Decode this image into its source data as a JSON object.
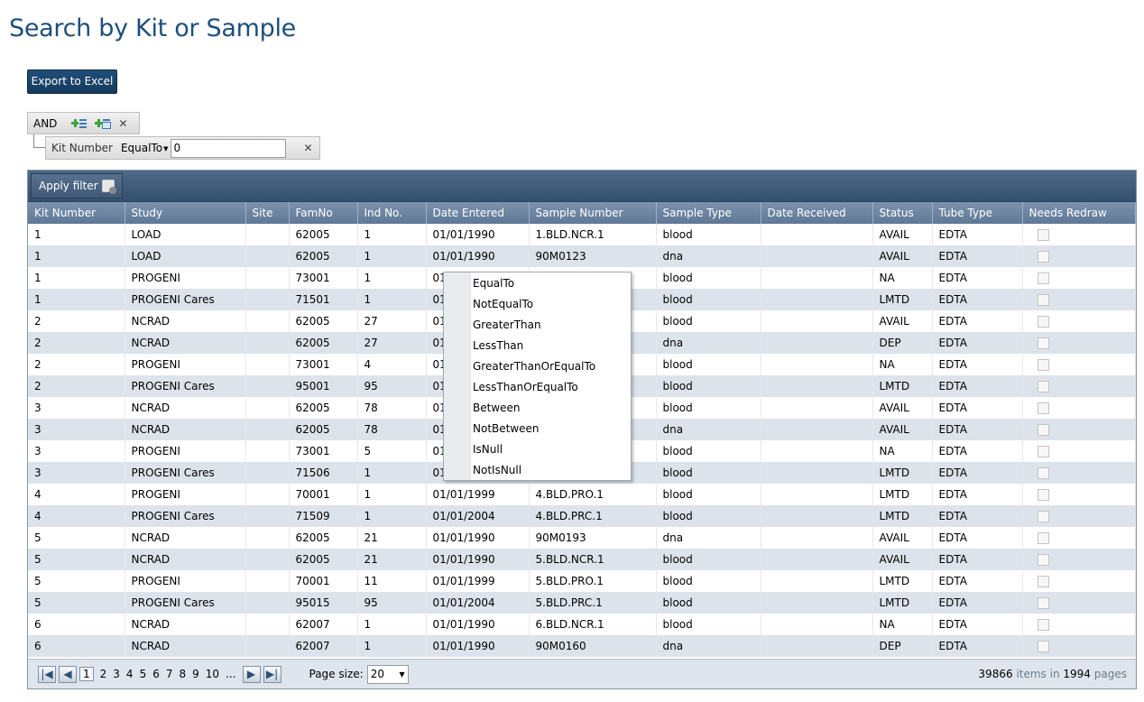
{
  "page": {
    "title": "Search by Kit or Sample"
  },
  "toolbar": {
    "export_label": "Export to Excel"
  },
  "filter": {
    "group_operator": "AND",
    "condition": {
      "field": "Kit Number",
      "operator": "EqualTo",
      "value": "0"
    }
  },
  "grid": {
    "apply_label": "Apply filter",
    "columns": [
      "Kit Number",
      "Study",
      "Site",
      "FamNo",
      "Ind No.",
      "Date Entered",
      "Sample Number",
      "Sample Type",
      "Date Received",
      "Status",
      "Tube Type",
      "Needs Redraw"
    ],
    "rows": [
      [
        "1",
        "LOAD",
        "",
        "62005",
        "1",
        "01/01/1990",
        "1.BLD.NCR.1",
        "blood",
        "",
        "AVAIL",
        "EDTA"
      ],
      [
        "1",
        "LOAD",
        "",
        "62005",
        "1",
        "01/01/1990",
        "90M0123",
        "dna",
        "",
        "AVAIL",
        "EDTA"
      ],
      [
        "1",
        "PROGENI",
        "",
        "73001",
        "1",
        "01",
        "",
        "blood",
        "",
        "NA",
        "EDTA"
      ],
      [
        "1",
        "PROGENI Cares",
        "",
        "71501",
        "1",
        "01",
        "",
        "blood",
        "",
        "LMTD",
        "EDTA"
      ],
      [
        "2",
        "NCRAD",
        "",
        "62005",
        "27",
        "01",
        "",
        "blood",
        "",
        "AVAIL",
        "EDTA"
      ],
      [
        "2",
        "NCRAD",
        "",
        "62005",
        "27",
        "01",
        "",
        "dna",
        "",
        "DEP",
        "EDTA"
      ],
      [
        "2",
        "PROGENI",
        "",
        "73001",
        "4",
        "01",
        "",
        "blood",
        "",
        "NA",
        "EDTA"
      ],
      [
        "2",
        "PROGENI Cares",
        "",
        "95001",
        "95",
        "01",
        "",
        "blood",
        "",
        "LMTD",
        "EDTA"
      ],
      [
        "3",
        "NCRAD",
        "",
        "62005",
        "78",
        "01",
        "",
        "blood",
        "",
        "AVAIL",
        "EDTA"
      ],
      [
        "3",
        "NCRAD",
        "",
        "62005",
        "78",
        "01",
        "",
        "dna",
        "",
        "AVAIL",
        "EDTA"
      ],
      [
        "3",
        "PROGENI",
        "",
        "73001",
        "5",
        "01",
        "",
        "blood",
        "",
        "NA",
        "EDTA"
      ],
      [
        "3",
        "PROGENI Cares",
        "",
        "71506",
        "1",
        "01",
        "",
        "blood",
        "",
        "LMTD",
        "EDTA"
      ],
      [
        "4",
        "PROGENI",
        "",
        "70001",
        "1",
        "01/01/1999",
        "4.BLD.PRO.1",
        "blood",
        "",
        "LMTD",
        "EDTA"
      ],
      [
        "4",
        "PROGENI Cares",
        "",
        "71509",
        "1",
        "01/01/2004",
        "4.BLD.PRC.1",
        "blood",
        "",
        "LMTD",
        "EDTA"
      ],
      [
        "5",
        "NCRAD",
        "",
        "62005",
        "21",
        "01/01/1990",
        "90M0193",
        "dna",
        "",
        "AVAIL",
        "EDTA"
      ],
      [
        "5",
        "NCRAD",
        "",
        "62005",
        "21",
        "01/01/1990",
        "5.BLD.NCR.1",
        "blood",
        "",
        "AVAIL",
        "EDTA"
      ],
      [
        "5",
        "PROGENI",
        "",
        "70001",
        "11",
        "01/01/1999",
        "5.BLD.PRO.1",
        "blood",
        "",
        "LMTD",
        "EDTA"
      ],
      [
        "5",
        "PROGENI Cares",
        "",
        "95015",
        "95",
        "01/01/2004",
        "5.BLD.PRC.1",
        "blood",
        "",
        "LMTD",
        "EDTA"
      ],
      [
        "6",
        "NCRAD",
        "",
        "62007",
        "1",
        "01/01/1990",
        "6.BLD.NCR.1",
        "blood",
        "",
        "NA",
        "EDTA"
      ],
      [
        "6",
        "NCRAD",
        "",
        "62007",
        "1",
        "01/01/1990",
        "90M0160",
        "dna",
        "",
        "DEP",
        "EDTA"
      ]
    ]
  },
  "pager": {
    "pages": [
      "1",
      "2",
      "3",
      "4",
      "5",
      "6",
      "7",
      "8",
      "9",
      "10",
      "..."
    ],
    "current_page": "1",
    "page_size_label": "Page size:",
    "page_size": "20",
    "total_items": "39866",
    "items_in_label": "items in",
    "total_pages": "1994",
    "pages_label": "pages"
  },
  "operator_menu": {
    "items": [
      "EqualTo",
      "NotEqualTo",
      "GreaterThan",
      "LessThan",
      "GreaterThanOrEqualTo",
      "LessThanOrEqualTo",
      "Between",
      "NotBetween",
      "IsNull",
      "NotIsNull"
    ]
  },
  "colors": {
    "title": "#1d4f7c",
    "header_bar": "#34506f",
    "row_alt": "#dde3ea"
  }
}
